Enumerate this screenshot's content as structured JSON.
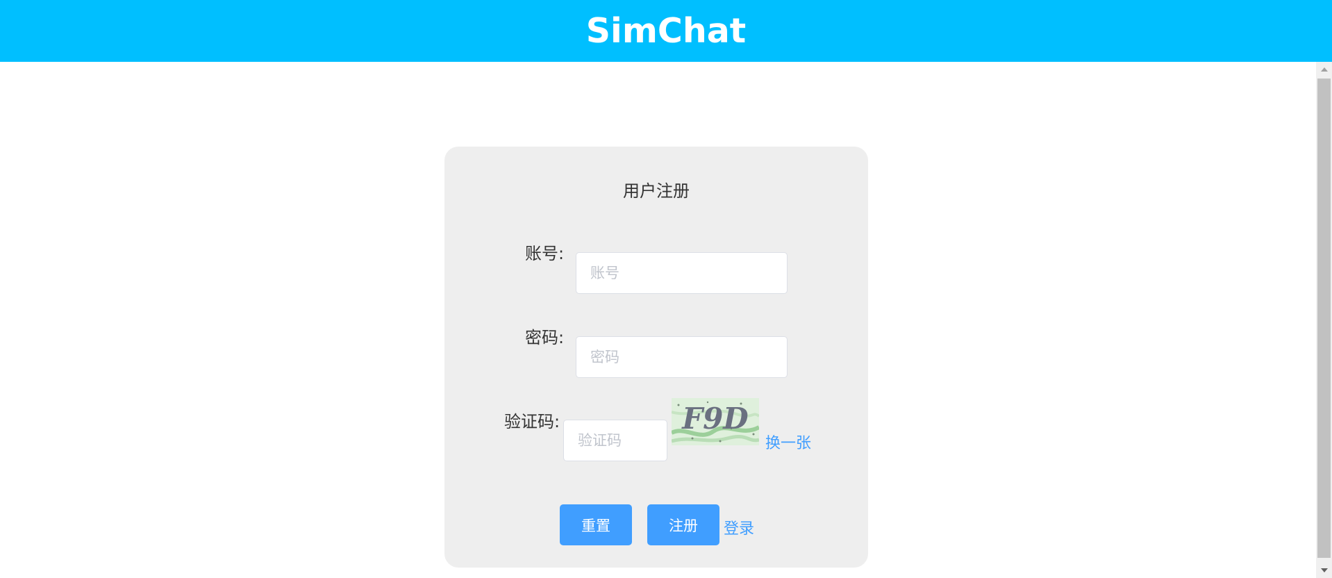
{
  "header": {
    "title": "SimChat"
  },
  "form": {
    "title": "用户注册",
    "account": {
      "label": "账号:",
      "placeholder": "账号",
      "value": ""
    },
    "password": {
      "label": "密码:",
      "placeholder": "密码",
      "value": ""
    },
    "captcha": {
      "label": "验证码:",
      "placeholder": "验证码",
      "value": "",
      "image_text": "F9D",
      "refresh_label": "换一张"
    },
    "buttons": {
      "reset_label": "重置",
      "register_label": "注册",
      "login_link": "登录"
    }
  },
  "colors": {
    "header_bg": "#00bfff",
    "card_bg": "#eeeeee",
    "primary": "#409eff",
    "link": "#409eff"
  },
  "icons": {
    "scroll_up": "scroll-up-arrow-icon",
    "scroll_down": "scroll-down-arrow-icon",
    "captcha": "captcha-image"
  }
}
